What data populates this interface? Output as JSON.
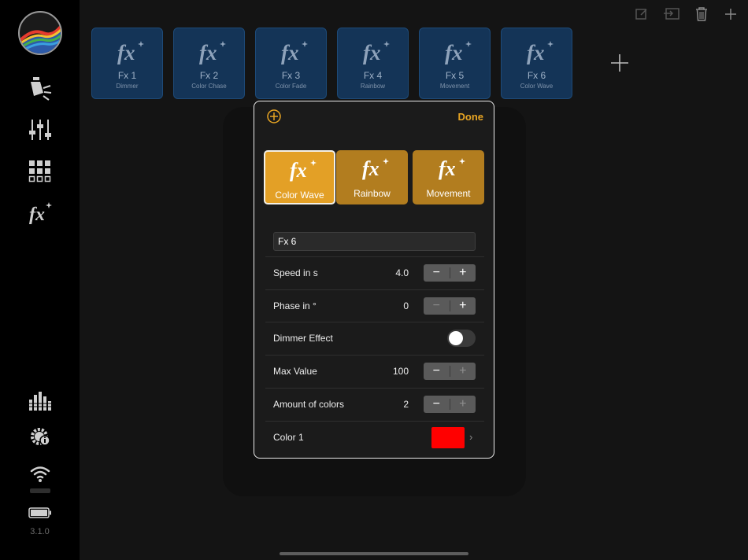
{
  "app": {
    "version": "3.1.0",
    "accent": "#e8a523",
    "tile_color": "#143457"
  },
  "sidebar": {
    "items": [
      {
        "icon": "fixture-light-icon"
      },
      {
        "icon": "faders-icon"
      },
      {
        "icon": "grid-icon"
      },
      {
        "icon": "fx-icon"
      },
      {
        "icon": "audio-bars-icon"
      },
      {
        "icon": "settings-info-icon"
      },
      {
        "icon": "wifi-icon"
      },
      {
        "icon": "battery-icon"
      }
    ]
  },
  "toolbar": {
    "icons": [
      "edit-icon",
      "import-icon",
      "trash-icon",
      "plus-icon"
    ]
  },
  "fx_tiles": [
    {
      "name": "Fx 1",
      "type": "Dimmer"
    },
    {
      "name": "Fx 2",
      "type": "Color Chase"
    },
    {
      "name": "Fx 3",
      "type": "Color Fade"
    },
    {
      "name": "Fx 4",
      "type": "Rainbow"
    },
    {
      "name": "Fx 5",
      "type": "Movement"
    },
    {
      "name": "Fx 6",
      "type": "Color Wave"
    }
  ],
  "fx_glyph": "fx",
  "popover": {
    "done_label": "Done",
    "presets": [
      "Color Wave",
      "Rainbow",
      "Movement"
    ],
    "selected_preset": "Color Wave",
    "name_value": "Fx 6",
    "rows": {
      "speed": {
        "label": "Speed in s",
        "value": "4.0"
      },
      "phase": {
        "label": "Phase in °",
        "value": "0"
      },
      "dimmer": {
        "label": "Dimmer Effect",
        "on": false
      },
      "max": {
        "label": "Max Value",
        "value": "100"
      },
      "colors": {
        "label": "Amount of colors",
        "value": "2"
      },
      "color1": {
        "label": "Color 1",
        "color": "#ff0000"
      }
    },
    "minus": "−",
    "plus": "+",
    "chevron": "›"
  }
}
